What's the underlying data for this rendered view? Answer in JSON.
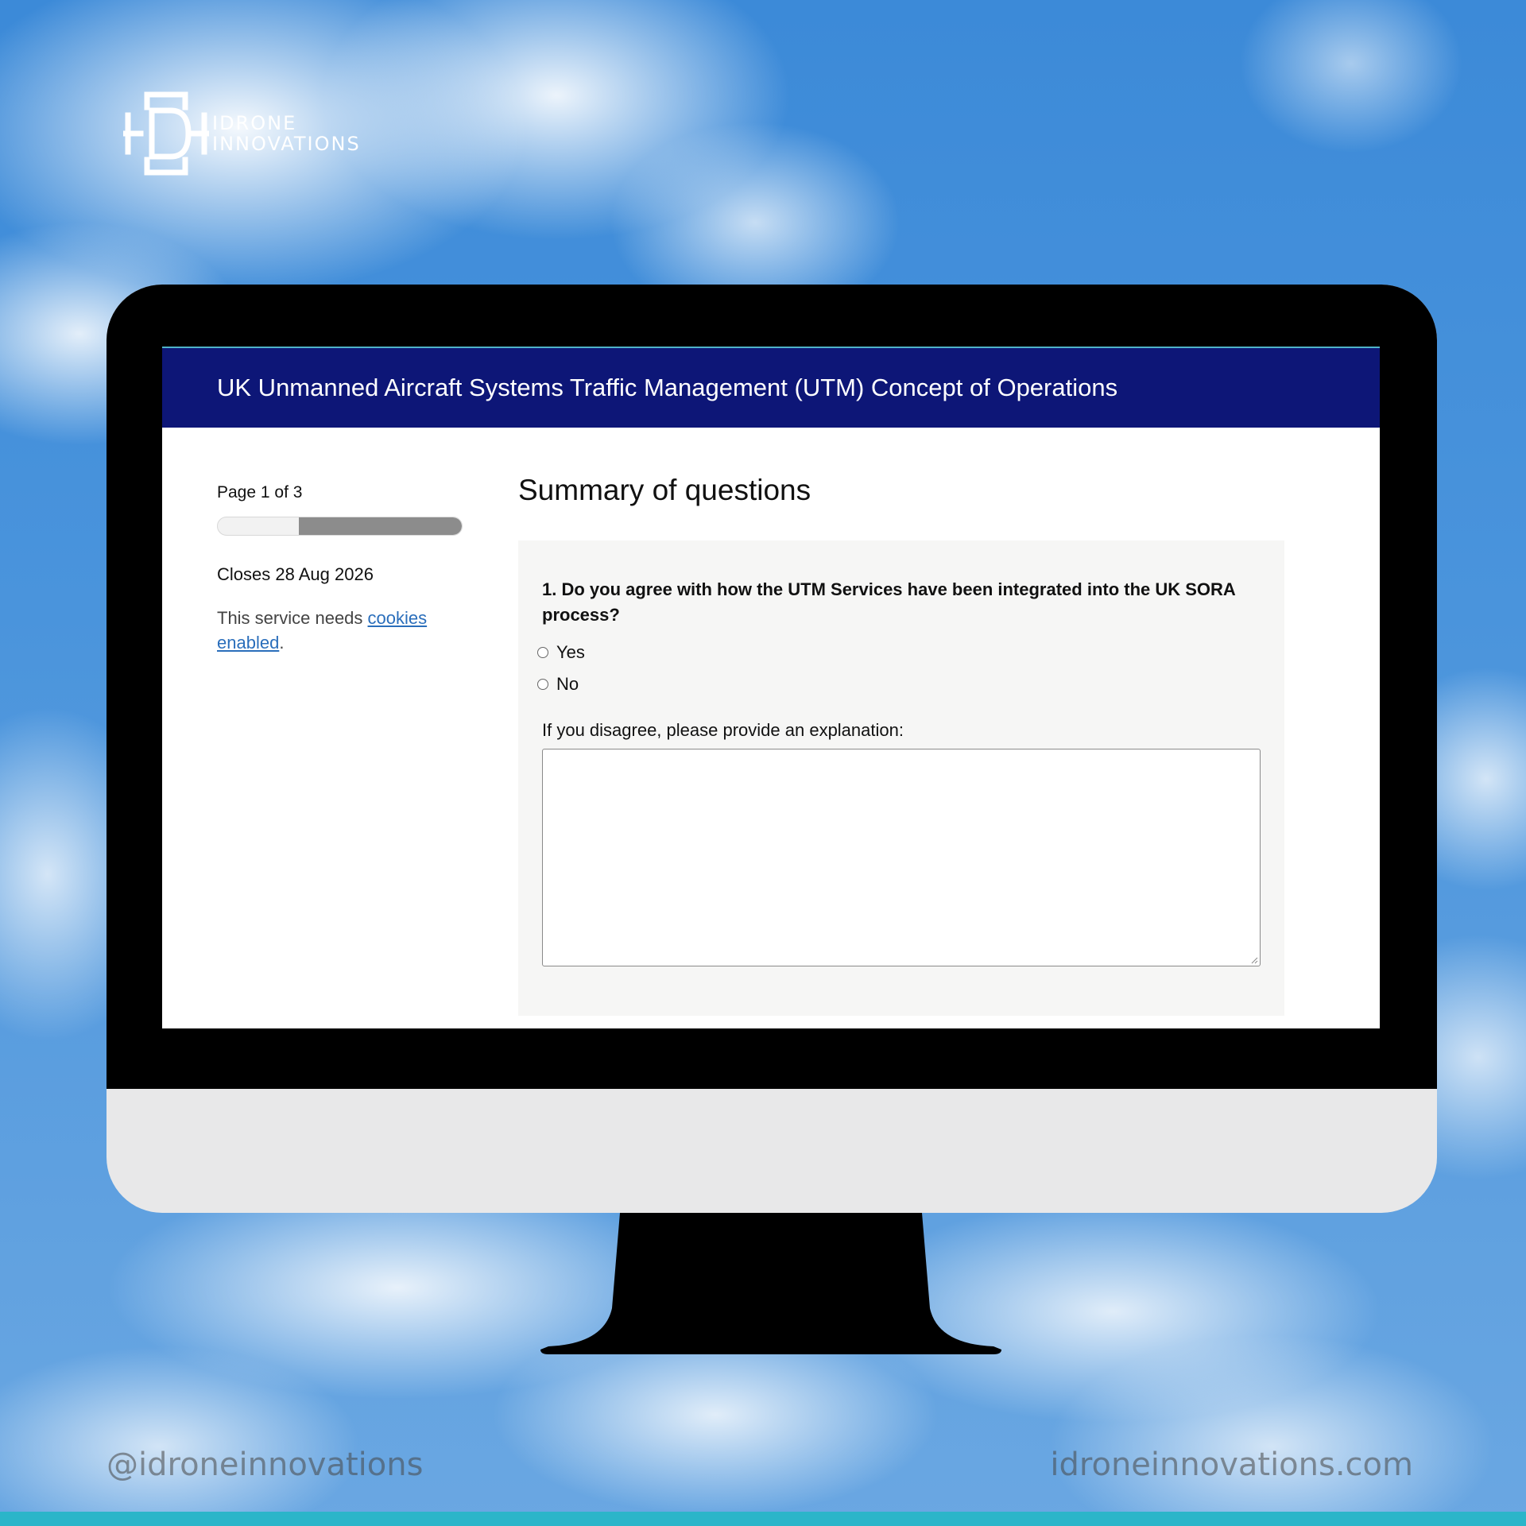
{
  "brand": {
    "line1": "IDRONE",
    "line2": "INNOVATIONS",
    "icon": "idi-monogram-icon"
  },
  "screen": {
    "title": "UK Unmanned Aircraft Systems Traffic Management (UTM) Concept of Operations",
    "sidebar": {
      "page_indicator": "Page 1 of 3",
      "progress_fraction": 0.667,
      "closes": "Closes 28 Aug 2026",
      "cookie_prefix": "This service needs ",
      "cookie_link": "cookies enabled",
      "cookie_suffix": "."
    },
    "main": {
      "heading": "Summary of questions",
      "question": "1. Do you agree with how the UTM Services have been integrated into the UK SORA process?",
      "options": [
        {
          "label": "Yes",
          "selected": false
        },
        {
          "label": "No",
          "selected": false
        }
      ],
      "explain_label": "If you disagree, please provide an explanation:",
      "explain_value": ""
    }
  },
  "footer": {
    "handle": "@idroneinnovations",
    "website": "idroneinnovations.com"
  },
  "colors": {
    "header_bg": "#0d1677",
    "link": "#2a6ebb",
    "accent_bar": "#2bb5c9"
  }
}
